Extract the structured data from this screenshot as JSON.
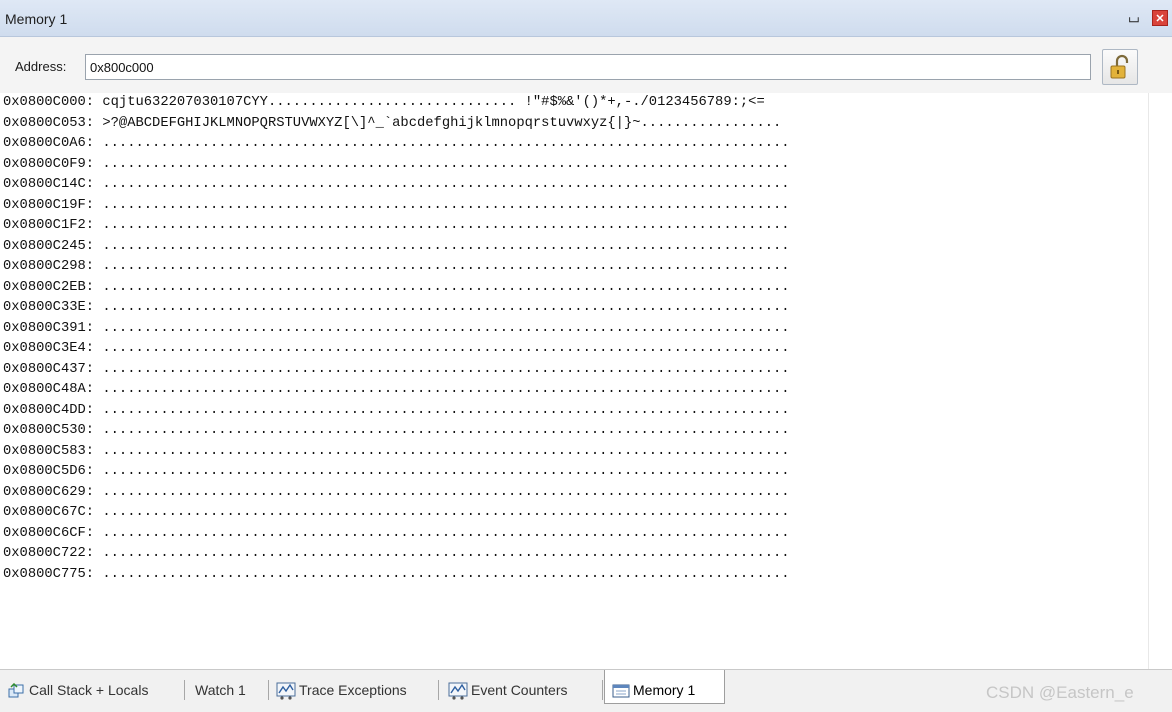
{
  "window": {
    "title": "Memory 1",
    "pin_icon": "pin-icon",
    "close_icon": "close-icon",
    "close_color": "#d9433a"
  },
  "address": {
    "label": "Address:",
    "value": "0x800c000",
    "lock_icon": "unlocked-padlock-icon"
  },
  "memory": {
    "rows": [
      {
        "address": "0x0800C000:",
        "data": "cqjtu632207030107CYY.............................. !\"#$%&'()*+,-./0123456789:;<="
      },
      {
        "address": "0x0800C053:",
        "data": ">?@ABCDEFGHIJKLMNOPQRSTUVWXYZ[\\]^_`abcdefghijklmnopqrstuvwxyz{|}~................."
      },
      {
        "address": "0x0800C0A6:",
        "data": "..................................................................................."
      },
      {
        "address": "0x0800C0F9:",
        "data": "..................................................................................."
      },
      {
        "address": "0x0800C14C:",
        "data": "..................................................................................."
      },
      {
        "address": "0x0800C19F:",
        "data": "..................................................................................."
      },
      {
        "address": "0x0800C1F2:",
        "data": "..................................................................................."
      },
      {
        "address": "0x0800C245:",
        "data": "..................................................................................."
      },
      {
        "address": "0x0800C298:",
        "data": "..................................................................................."
      },
      {
        "address": "0x0800C2EB:",
        "data": "..................................................................................."
      },
      {
        "address": "0x0800C33E:",
        "data": "..................................................................................."
      },
      {
        "address": "0x0800C391:",
        "data": "..................................................................................."
      },
      {
        "address": "0x0800C3E4:",
        "data": "..................................................................................."
      },
      {
        "address": "0x0800C437:",
        "data": "..................................................................................."
      },
      {
        "address": "0x0800C48A:",
        "data": "..................................................................................."
      },
      {
        "address": "0x0800C4DD:",
        "data": "..................................................................................."
      },
      {
        "address": "0x0800C530:",
        "data": "..................................................................................."
      },
      {
        "address": "0x0800C583:",
        "data": "..................................................................................."
      },
      {
        "address": "0x0800C5D6:",
        "data": "..................................................................................."
      },
      {
        "address": "0x0800C629:",
        "data": "..................................................................................."
      },
      {
        "address": "0x0800C67C:",
        "data": "..................................................................................."
      },
      {
        "address": "0x0800C6CF:",
        "data": "..................................................................................."
      },
      {
        "address": "0x0800C722:",
        "data": "..................................................................................."
      },
      {
        "address": "0x0800C775:",
        "data": "..................................................................................."
      }
    ]
  },
  "tabs": [
    {
      "label": "Call Stack + Locals",
      "icon": "call-stack-icon",
      "active": false
    },
    {
      "label": "Watch 1",
      "icon": "",
      "active": false
    },
    {
      "label": "Trace Exceptions",
      "icon": "trace-exceptions-icon",
      "active": false
    },
    {
      "label": "Event Counters",
      "icon": "event-counters-icon",
      "active": false
    },
    {
      "label": "Memory 1",
      "icon": "memory-icon",
      "active": true
    }
  ],
  "watermark": "CSDN @Eastern_e"
}
